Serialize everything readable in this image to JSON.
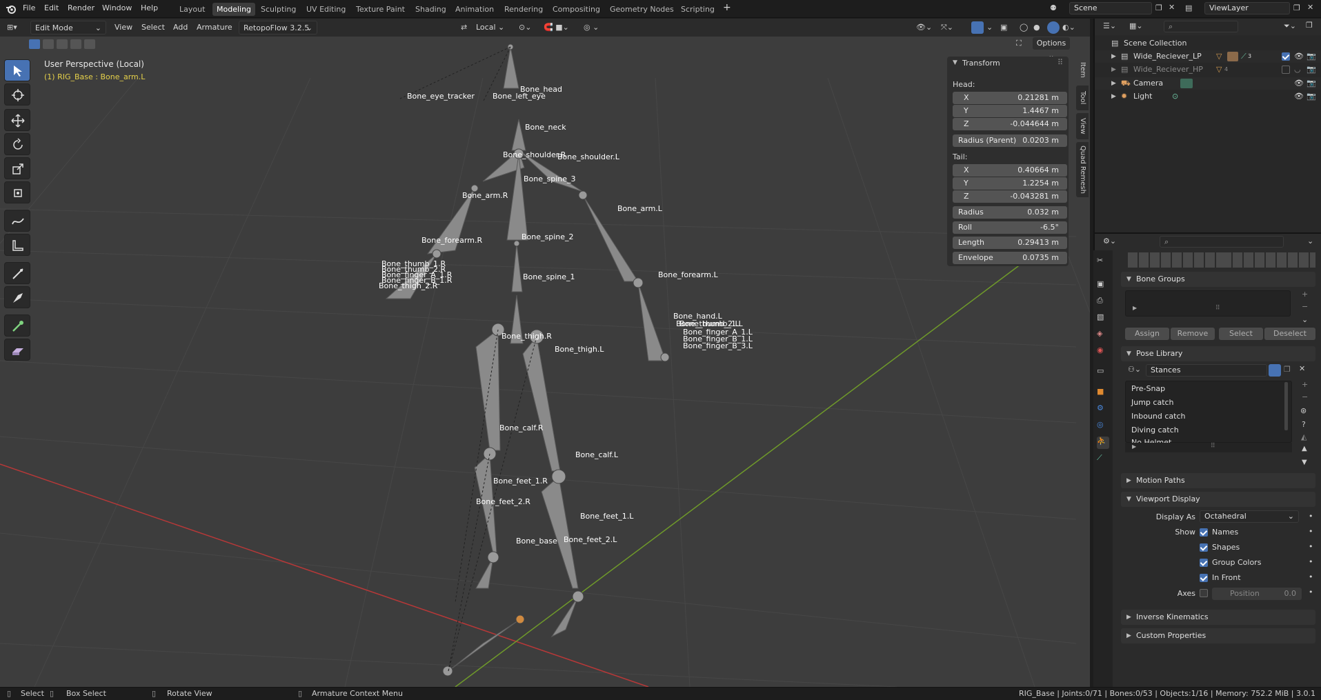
{
  "menu": {
    "items": [
      "File",
      "Edit",
      "Render",
      "Window",
      "Help"
    ]
  },
  "workspaces": [
    "Layout",
    "Modeling",
    "Sculpting",
    "UV Editing",
    "Texture Paint",
    "Shading",
    "Animation",
    "Rendering",
    "Compositing",
    "Geometry Nodes",
    "Scripting"
  ],
  "active_workspace": "Modeling",
  "scene": {
    "label": "Scene",
    "view_layer": "ViewLayer"
  },
  "viewport_header": {
    "mode": "Edit Mode",
    "menus": [
      "View",
      "Select",
      "Add",
      "Armature"
    ],
    "addon": "RetopoFlow 3.2.5",
    "transform_orientation": "Local",
    "options": "Options"
  },
  "overlay": {
    "perspective": "User Perspective (Local)",
    "object_info": "(1) RIG_Base : Bone_arm.L"
  },
  "bone_labels": [
    "Bone_eye_tracker",
    "Bone_head",
    "Bone_left_eye",
    "Bone_neck",
    "Bone_shoulder.R",
    "Bone_shoulder.L",
    "Bone_spine_3",
    "Bone_arm.R",
    "Bone_arm.L",
    "Bone_forearm.R",
    "Bone_spine_2",
    "Bone_thumb_1.R",
    "Bone_thumb_2.R",
    "Bone_finger_A_1.R",
    "Bone_finger_B_1.R",
    "Bone_thigh_2.R",
    "Bone_spine_1",
    "Bone_forearm.L",
    "Bone_hand.L",
    "Bone_thumb_1.L",
    "Bone_thumb_2.L",
    "Bone_finger_A_1.L",
    "Bone_finger_B_1.L",
    "Bone_finger_B_3.L",
    "Bone_thigh.R",
    "Bone_thigh.L",
    "Bone_calf.R",
    "Bone_calf.L",
    "Bone_feet_1.R",
    "Bone_feet_2.R",
    "Bone_feet_1.L",
    "Bone_base",
    "Bone_feet_2.L"
  ],
  "transform": {
    "title": "Transform",
    "head_label": "Head:",
    "head": [
      {
        "k": "X",
        "v": "0.21281 m"
      },
      {
        "k": "Y",
        "v": "1.4467 m"
      },
      {
        "k": "Z",
        "v": "-0.044644 m"
      }
    ],
    "radius_parent": {
      "k": "Radius (Parent)",
      "v": "0.0203 m"
    },
    "tail_label": "Tail:",
    "tail": [
      {
        "k": "X",
        "v": "0.40664 m"
      },
      {
        "k": "Y",
        "v": "1.2254 m"
      },
      {
        "k": "Z",
        "v": "-0.043281 m"
      }
    ],
    "extra": [
      {
        "k": "Radius",
        "v": "0.032 m"
      },
      {
        "k": "Roll",
        "v": "-6.5°"
      },
      {
        "k": "Length",
        "v": "0.29413 m"
      },
      {
        "k": "Envelope",
        "v": "0.0735 m"
      }
    ]
  },
  "n_tabs": [
    "Item",
    "Tool",
    "View",
    "Quad Remesh"
  ],
  "outliner": {
    "root": "Scene Collection",
    "items": [
      {
        "name": "Wide_Reciever_LP",
        "badge": "3",
        "dim": false
      },
      {
        "name": "Wide_Reciever_HP",
        "badge": "4",
        "dim": true
      },
      {
        "name": "Camera",
        "badge": "",
        "dim": false
      },
      {
        "name": "Light",
        "badge": "",
        "dim": false
      }
    ]
  },
  "properties": {
    "bone_groups": {
      "title": "Bone Groups",
      "buttons": [
        "Assign",
        "Remove",
        "Select",
        "Deselect"
      ]
    },
    "pose_library": {
      "title": "Pose Library",
      "active": "Stances",
      "poses": [
        "Pre-Snap",
        "Jump catch",
        "Inbound catch",
        "Diving catch",
        "No Helmet"
      ]
    },
    "motion_paths": "Motion Paths",
    "viewport_display": {
      "title": "Viewport Display",
      "display_as_label": "Display As",
      "display_as": "Octahedral",
      "show_label": "Show",
      "show": [
        "Names",
        "Shapes",
        "Group Colors",
        "In Front"
      ],
      "axes_label": "Axes",
      "position_label": "Position",
      "position_value": "0.0"
    },
    "inverse_kinematics": "Inverse Kinematics",
    "custom_properties": "Custom Properties"
  },
  "status": {
    "select": "Select",
    "box_select": "Box Select",
    "rotate_view": "Rotate View",
    "context_menu": "Armature Context Menu",
    "stats": "RIG_Base | Joints:0/71 | Bones:0/53 | Objects:1/16 | Memory: 752.2 MiB | 3.0.1"
  },
  "colors": {
    "accent": "#4772b3",
    "x_axis": "#b83838",
    "y_axis": "#6f9a2a",
    "viewport_bg": "#3d3d3d"
  }
}
